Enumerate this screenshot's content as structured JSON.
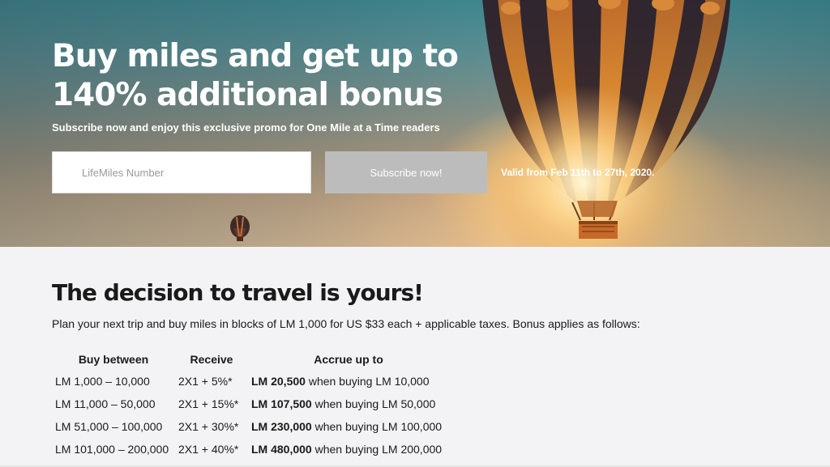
{
  "hero": {
    "title": "Buy miles and get up to 140% additional bonus",
    "subtitle": "Subscribe now and enjoy this exclusive promo for One Mile at a Time readers",
    "input_placeholder": "LifeMiles Number",
    "subscribe_label": "Subscribe now!",
    "valid_text": "Valid from Feb 11th to 27th, 2020."
  },
  "section": {
    "title": "The decision to travel is yours!",
    "description": "Plan your next trip and buy miles in blocks of LM 1,000 for US $33 each + applicable taxes. Bonus applies as follows:"
  },
  "table": {
    "headers": [
      "Buy between",
      "Receive",
      "Accrue up to"
    ],
    "rows": [
      {
        "range": "LM 1,000 – 10,000",
        "receive": "2X1 + 5%*",
        "accrue_amount": "LM 20,500",
        "accrue_note": " when buying LM 10,000"
      },
      {
        "range": "LM 11,000 – 50,000",
        "receive": "2X1 + 15%*",
        "accrue_amount": "LM 107,500",
        "accrue_note": " when buying LM 50,000"
      },
      {
        "range": "LM 51,000 – 100,000",
        "receive": "2X1 + 30%*",
        "accrue_amount": "LM 230,000",
        "accrue_note": " when buying LM 100,000"
      },
      {
        "range": "LM 101,000 – 200,000",
        "receive": "2X1 + 40%*",
        "accrue_amount": "LM 480,000",
        "accrue_note": " when buying LM 200,000"
      }
    ]
  },
  "icons": {
    "hero_image": "hot-air-balloon-sunset-image"
  }
}
